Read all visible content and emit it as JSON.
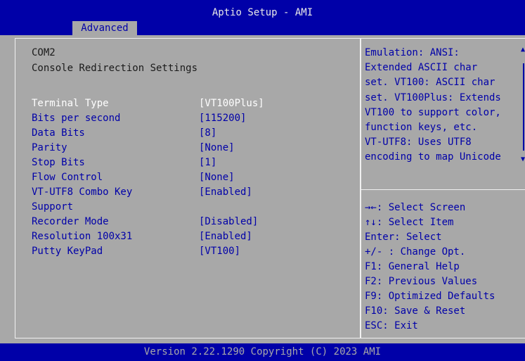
{
  "header": {
    "title": "Aptio Setup - AMI",
    "tabs": [
      {
        "label": "Advanced",
        "active": true
      }
    ]
  },
  "main": {
    "heading": "COM2",
    "subheading": "Console Redirection Settings",
    "settings": [
      {
        "label": "Terminal Type",
        "value": "[VT100Plus]",
        "selected": true
      },
      {
        "label": "Bits per second",
        "value": "[115200]",
        "selected": false
      },
      {
        "label": "Data Bits",
        "value": "[8]",
        "selected": false
      },
      {
        "label": "Parity",
        "value": "[None]",
        "selected": false
      },
      {
        "label": "Stop Bits",
        "value": "[1]",
        "selected": false
      },
      {
        "label": "Flow Control",
        "value": "[None]",
        "selected": false
      },
      {
        "label": "VT-UTF8 Combo Key",
        "label_cont": "Support",
        "value": "[Enabled]",
        "selected": false
      },
      {
        "label": "Recorder Mode",
        "value": "[Disabled]",
        "selected": false
      },
      {
        "label": "Resolution 100x31",
        "value": "[Enabled]",
        "selected": false
      },
      {
        "label": "Putty KeyPad",
        "value": "[VT100]",
        "selected": false
      }
    ]
  },
  "help": {
    "lines": [
      "Emulation: ANSI:",
      "Extended ASCII char",
      "set. VT100: ASCII char",
      "set. VT100Plus: Extends",
      "VT100 to support color,",
      "function keys, etc.",
      "VT-UTF8: Uses UTF8",
      "encoding to map Unicode"
    ],
    "scroll_up_icon": "▲",
    "scroll_down_icon": "▼"
  },
  "keys": [
    "→←: Select Screen",
    "↑↓: Select Item",
    "Enter: Select",
    "+/- : Change Opt.",
    "F1: General Help",
    "F2: Previous Values",
    "F9: Optimized Defaults",
    "F10: Save & Reset",
    "ESC: Exit"
  ],
  "footer": {
    "version": "Version 2.22.1290 Copyright (C) 2023 AMI"
  },
  "colors": {
    "bar_blue": "#0000a8",
    "panel_gray": "#a8a8a8",
    "highlight_white": "#ffffff",
    "text_dark": "#1a1a1a",
    "text_blue": "#0000a8"
  }
}
